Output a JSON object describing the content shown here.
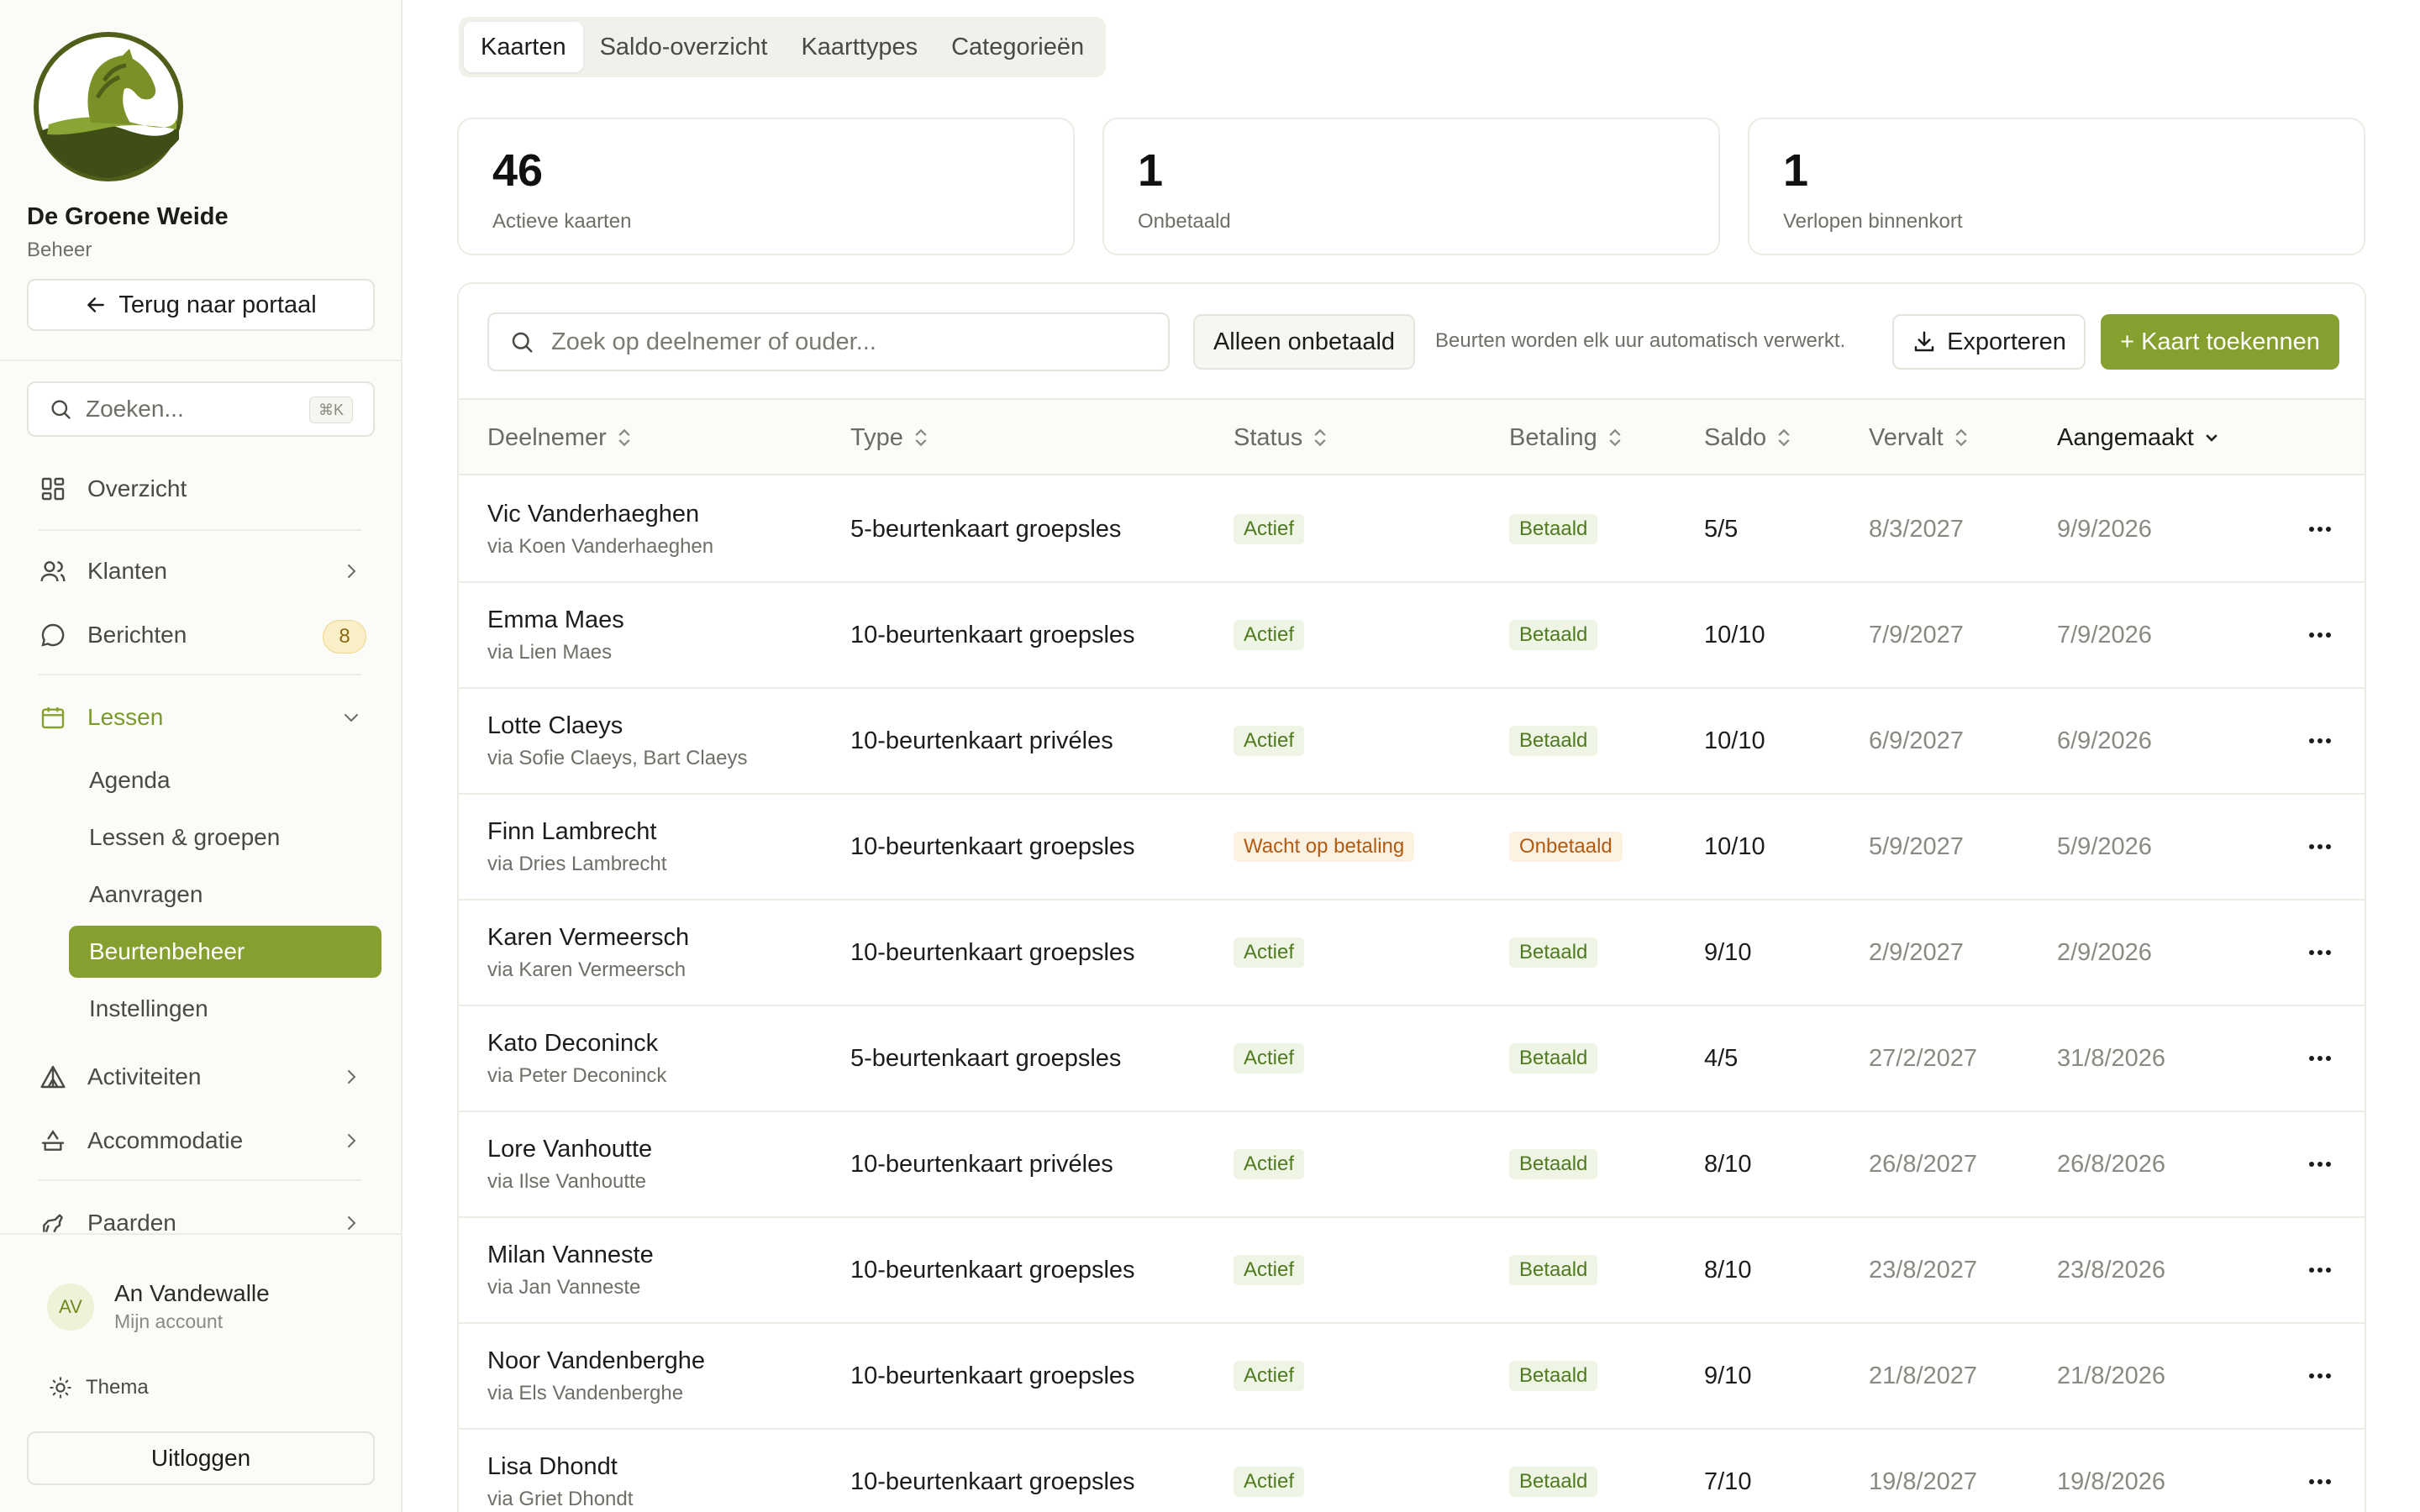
{
  "sidebar": {
    "org_name": "De Groene Weide",
    "org_role": "Beheer",
    "back_label": "Terug naar portaal",
    "search_placeholder": "Zoeken...",
    "search_shortcut": "⌘K",
    "nav": {
      "overview": "Overzicht",
      "clients": "Klanten",
      "messages": "Berichten",
      "messages_badge": "8",
      "lessons": "Lessen",
      "activities": "Activiteiten",
      "accommodation": "Accommodatie",
      "horses": "Paarden"
    },
    "lessons_sub": [
      "Agenda",
      "Lessen & groepen",
      "Aanvragen",
      "Beurtenbeheer",
      "Instellingen"
    ],
    "active_sub": "Beurtenbeheer",
    "user": {
      "initials": "AV",
      "name": "An Vandewalle",
      "sub": "Mijn account"
    },
    "theme_label": "Thema",
    "logout_label": "Uitloggen"
  },
  "tabs": [
    "Kaarten",
    "Saldo-overzicht",
    "Kaarttypes",
    "Categorieën"
  ],
  "active_tab": "Kaarten",
  "stats": [
    {
      "value": "46",
      "label": "Actieve kaarten"
    },
    {
      "value": "1",
      "label": "Onbetaald"
    },
    {
      "value": "1",
      "label": "Verlopen binnenkort"
    }
  ],
  "toolbar": {
    "search_placeholder": "Zoek op deelnemer of ouder...",
    "unpaid_filter": "Alleen onbetaald",
    "auto_note": "Beurten worden elk uur automatisch verwerkt.",
    "export_label": "Exporteren",
    "assign_label": "+ Kaart toekennen"
  },
  "columns": {
    "participant": "Deelnemer",
    "type": "Type",
    "status": "Status",
    "payment": "Betaling",
    "balance": "Saldo",
    "expires": "Vervalt",
    "created": "Aangemaakt"
  },
  "sorted_column": "Aangemaakt",
  "rows": [
    {
      "name": "Vic Vanderhaeghen",
      "via": "via Koen Vanderhaeghen",
      "type": "5-beurtenkaart groepsles",
      "status": "Actief",
      "payment": "Betaald",
      "balance": "5/5",
      "expires": "8/3/2027",
      "created": "9/9/2026"
    },
    {
      "name": "Emma Maes",
      "via": "via Lien Maes",
      "type": "10-beurtenkaart groepsles",
      "status": "Actief",
      "payment": "Betaald",
      "balance": "10/10",
      "expires": "7/9/2027",
      "created": "7/9/2026"
    },
    {
      "name": "Lotte Claeys",
      "via": "via Sofie Claeys, Bart Claeys",
      "type": "10-beurtenkaart privéles",
      "status": "Actief",
      "payment": "Betaald",
      "balance": "10/10",
      "expires": "6/9/2027",
      "created": "6/9/2026"
    },
    {
      "name": "Finn Lambrecht",
      "via": "via Dries Lambrecht",
      "type": "10-beurtenkaart groepsles",
      "status": "Wacht op betaling",
      "payment": "Onbetaald",
      "balance": "10/10",
      "expires": "5/9/2027",
      "created": "5/9/2026"
    },
    {
      "name": "Karen Vermeersch",
      "via": "via Karen Vermeersch",
      "type": "10-beurtenkaart groepsles",
      "status": "Actief",
      "payment": "Betaald",
      "balance": "9/10",
      "expires": "2/9/2027",
      "created": "2/9/2026"
    },
    {
      "name": "Kato Deconinck",
      "via": "via Peter Deconinck",
      "type": "5-beurtenkaart groepsles",
      "status": "Actief",
      "payment": "Betaald",
      "balance": "4/5",
      "expires": "27/2/2027",
      "created": "31/8/2026"
    },
    {
      "name": "Lore Vanhoutte",
      "via": "via Ilse Vanhoutte",
      "type": "10-beurtenkaart privéles",
      "status": "Actief",
      "payment": "Betaald",
      "balance": "8/10",
      "expires": "26/8/2027",
      "created": "26/8/2026"
    },
    {
      "name": "Milan Vanneste",
      "via": "via Jan Vanneste",
      "type": "10-beurtenkaart groepsles",
      "status": "Actief",
      "payment": "Betaald",
      "balance": "8/10",
      "expires": "23/8/2027",
      "created": "23/8/2026"
    },
    {
      "name": "Noor Vandenberghe",
      "via": "via Els Vandenberghe",
      "type": "10-beurtenkaart groepsles",
      "status": "Actief",
      "payment": "Betaald",
      "balance": "9/10",
      "expires": "21/8/2027",
      "created": "21/8/2026"
    },
    {
      "name": "Lisa Dhondt",
      "via": "via Griet Dhondt",
      "type": "10-beurtenkaart groepsles",
      "status": "Actief",
      "payment": "Betaald",
      "balance": "7/10",
      "expires": "19/8/2027",
      "created": "19/8/2026"
    }
  ],
  "colors": {
    "accent": "#86a02f",
    "paid_bg": "#eef5e4",
    "paid_text": "#4f7a1f",
    "unpaid_bg": "#fdf1e2",
    "unpaid_text": "#b15a12"
  }
}
